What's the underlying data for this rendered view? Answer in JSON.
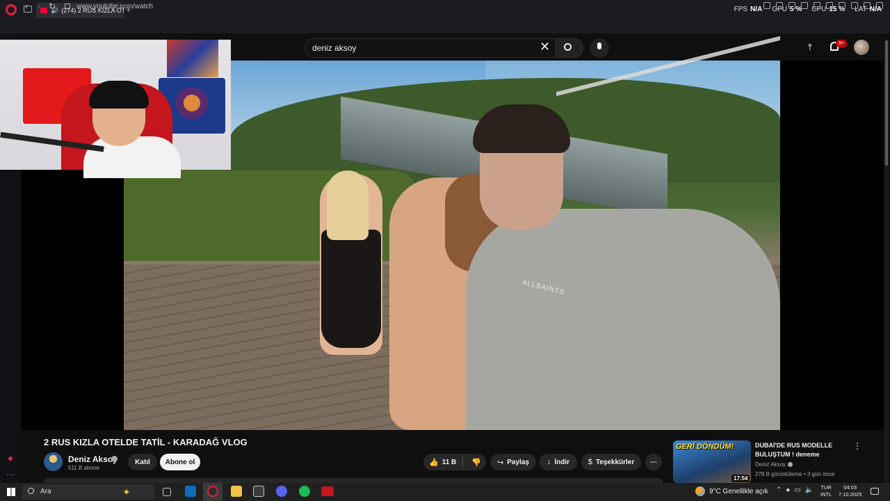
{
  "browser": {
    "tab_title": "(274) 2 RUS KIZLA OT",
    "new_tab": "+",
    "url": "www.youtube.com/watch",
    "perf": [
      {
        "label": "FPS",
        "value": "N/A"
      },
      {
        "label": "GPU",
        "value": "5 %"
      },
      {
        "label": "CPU",
        "value": "15 %"
      },
      {
        "label": "LAT",
        "value": "N/A"
      }
    ]
  },
  "youtube": {
    "search_query": "deniz aksoy",
    "notification_count": "9+",
    "video": {
      "title": "2 RUS KIZLA OTELDE TATİL - KARADAĞ VLOG",
      "shirt_text": "ALLSAINTS",
      "channel_name": "Deniz Aksoy",
      "subscribers": "511 B abone",
      "join_label": "Katıl",
      "subscribe_label": "Abone ol",
      "like_count": "11 B",
      "share_label": "Paylaş",
      "download_label": "İndir",
      "thanks_label": "Teşekkürler"
    },
    "recommended": {
      "thumb_text": "GERİ DÖNDÜM!",
      "duration": "17:54",
      "title": "DUBAİ'DE RUS MODELLE BULUŞTUM ! deneme",
      "channel": "Deniz Aksoy",
      "meta": "278 B görüntüleme • 3 gün önce"
    }
  },
  "taskbar": {
    "search_label": "Ara",
    "weather": "9°C  Genellikle açık",
    "lang_line1": "TUR",
    "lang_line2": "INTL",
    "time": "04:03",
    "date": "7.10.2025"
  },
  "colors": {
    "opera_red": "#e5213a",
    "youtube_red": "#ff0033",
    "background": "#0f0f0f"
  }
}
